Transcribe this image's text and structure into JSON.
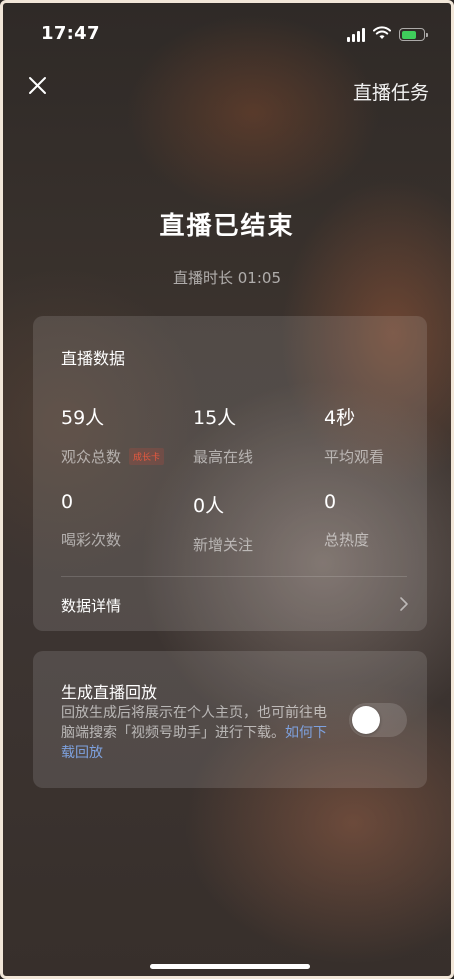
{
  "status_bar": {
    "time": "17:47",
    "battery_color": "#3fcd5b"
  },
  "header": {
    "close_icon": "close-icon",
    "task_label": "直播任务"
  },
  "title": "直播已结束",
  "duration": "直播时长 01:05",
  "stats_card": {
    "title": "直播数据",
    "stats": [
      {
        "value": "59人",
        "label": "观众总数",
        "badge": "成长卡"
      },
      {
        "value": "15人",
        "label": "最高在线"
      },
      {
        "value": "4秒",
        "label": "平均观看"
      },
      {
        "value": "0",
        "label": "喝彩次数"
      },
      {
        "value": "0人",
        "label": "新增关注"
      },
      {
        "value": "0",
        "label": "总热度"
      }
    ],
    "detail_label": "数据详情"
  },
  "replay_card": {
    "title": "生成直播回放",
    "description": "回放生成后将展示在个人主页，也可前往电脑端搜索「视频号助手」进行下载。",
    "link_label": "如何下载回放",
    "toggle_on": false
  },
  "colors": {
    "link": "#7ea1de",
    "badge": "#e8593f"
  }
}
